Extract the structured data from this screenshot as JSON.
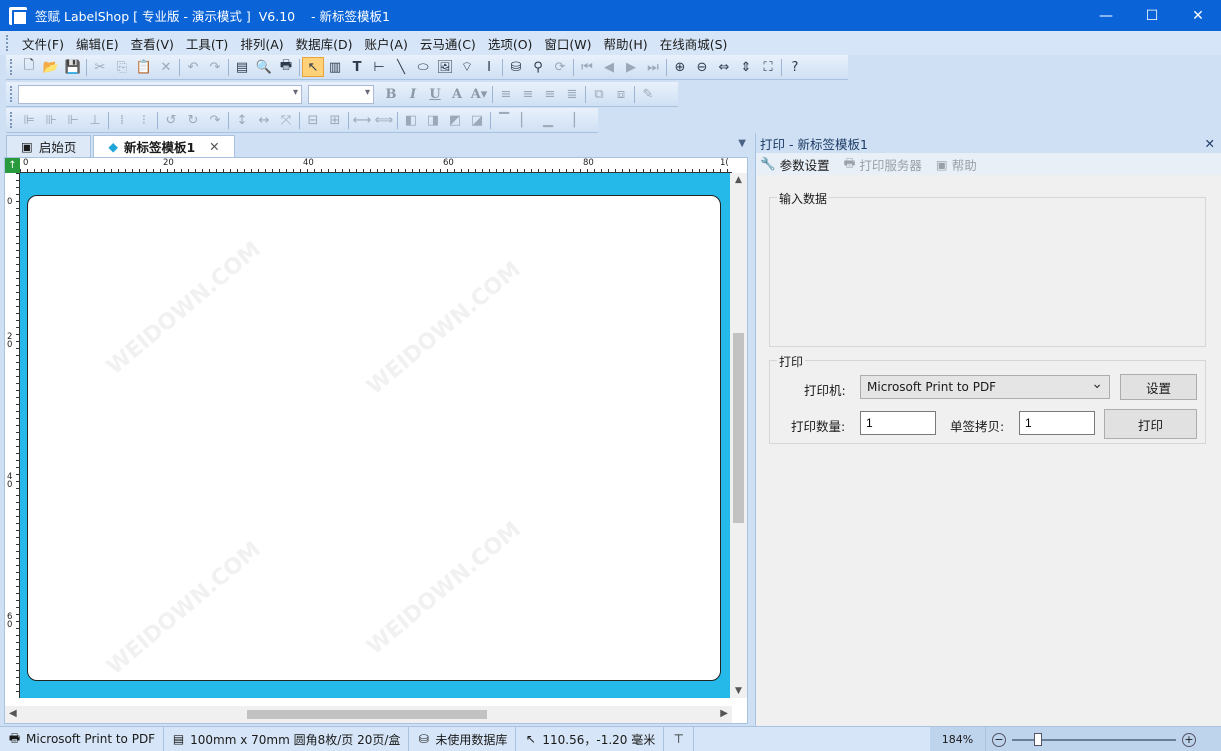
{
  "window": {
    "title": "签赋 LabelShop [ 专业版 - 演示模式 ]  V6.10    - 新标签模板1",
    "controls": {
      "minimize": "—",
      "maximize": "☐",
      "close": "✕"
    }
  },
  "menu": [
    "文件(F)",
    "编辑(E)",
    "查看(V)",
    "工具(T)",
    "排列(A)",
    "数据库(D)",
    "账户(A)",
    "云马通(C)",
    "选项(O)",
    "窗口(W)",
    "帮助(H)",
    "在线商城(S)"
  ],
  "doc_tabs": {
    "start": "启始页",
    "active": "新标签模板1",
    "close": "✕",
    "dropdown": "▼"
  },
  "ruler": {
    "h_labels": [
      "0",
      "20",
      "40",
      "60",
      "80",
      "1("
    ],
    "v_labels": [
      "0",
      "2\n0",
      "4\n0",
      "6\n0"
    ]
  },
  "side": {
    "header": "打印 - 新标签模板1",
    "close": "✕",
    "toolbar": {
      "params": "参数设置",
      "print_server": "打印服务器",
      "help": "帮助"
    },
    "input_group": "输入数据",
    "print_group": "打印",
    "printer_label": "打印机:",
    "printer_value": "Microsoft Print to PDF",
    "setup_button": "设置",
    "qty_label": "打印数量:",
    "qty_value": "1",
    "copies_label": "单签拷贝:",
    "copies_value": "1",
    "print_button": "打印"
  },
  "status": {
    "printer": "Microsoft Print to PDF",
    "paper": "100mm x 70mm 圆角8枚/页 20页/盒",
    "db": "未使用数据库",
    "coords": "110.56，-1.20 毫米",
    "zoom": "184%",
    "zoom_level": 0.14
  },
  "watermark": "WEIDOWN.COM"
}
